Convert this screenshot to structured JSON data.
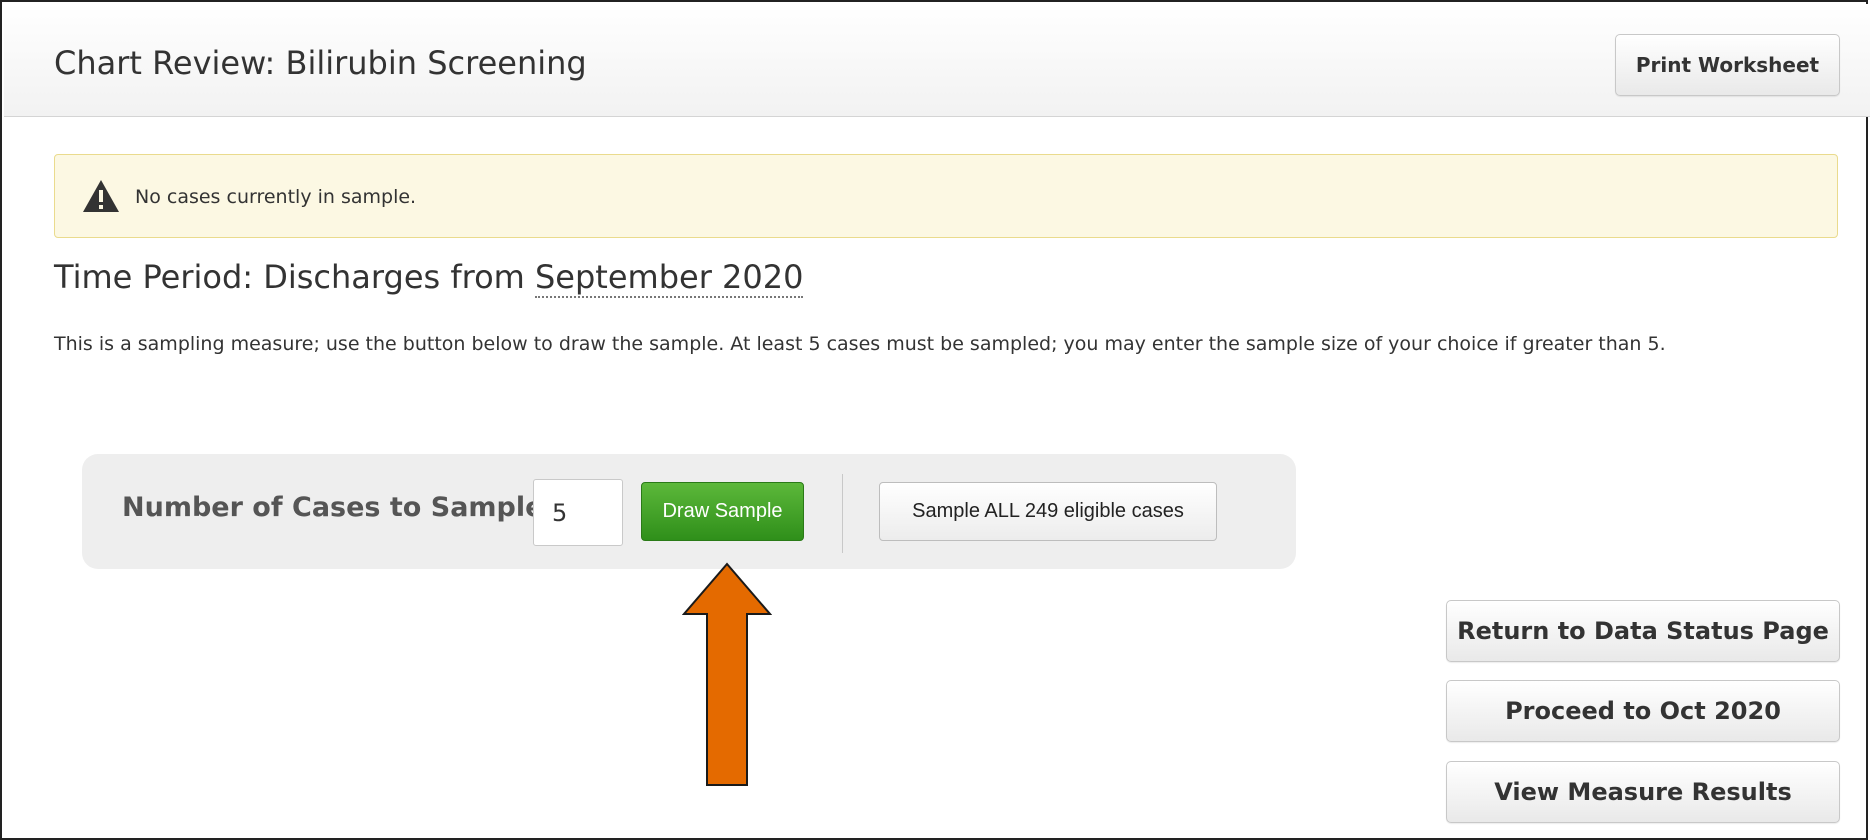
{
  "header": {
    "title": "Chart Review:  Bilirubin Screening",
    "print_label": "Print Worksheet"
  },
  "alert": {
    "icon": "warning-icon",
    "text": "No cases currently in sample."
  },
  "period": {
    "prefix": "Time Period: Discharges from ",
    "month": "September 2020"
  },
  "description": "This is a sampling measure; use the button below to draw the sample. At least 5 cases must be sampled; you may enter the sample size of your choice if greater than 5.",
  "sample": {
    "label": "Number of Cases to Sample:",
    "value": "5",
    "draw_label": "Draw Sample",
    "all_label": "Sample ALL 249 eligible cases"
  },
  "actions": {
    "return_label": "Return to Data Status Page",
    "proceed_label": "Proceed to Oct 2020",
    "results_label": "View Measure Results"
  },
  "colors": {
    "draw_button": "#3fa127",
    "alert_background": "#fcf8e3",
    "arrow": "#e46a00"
  }
}
